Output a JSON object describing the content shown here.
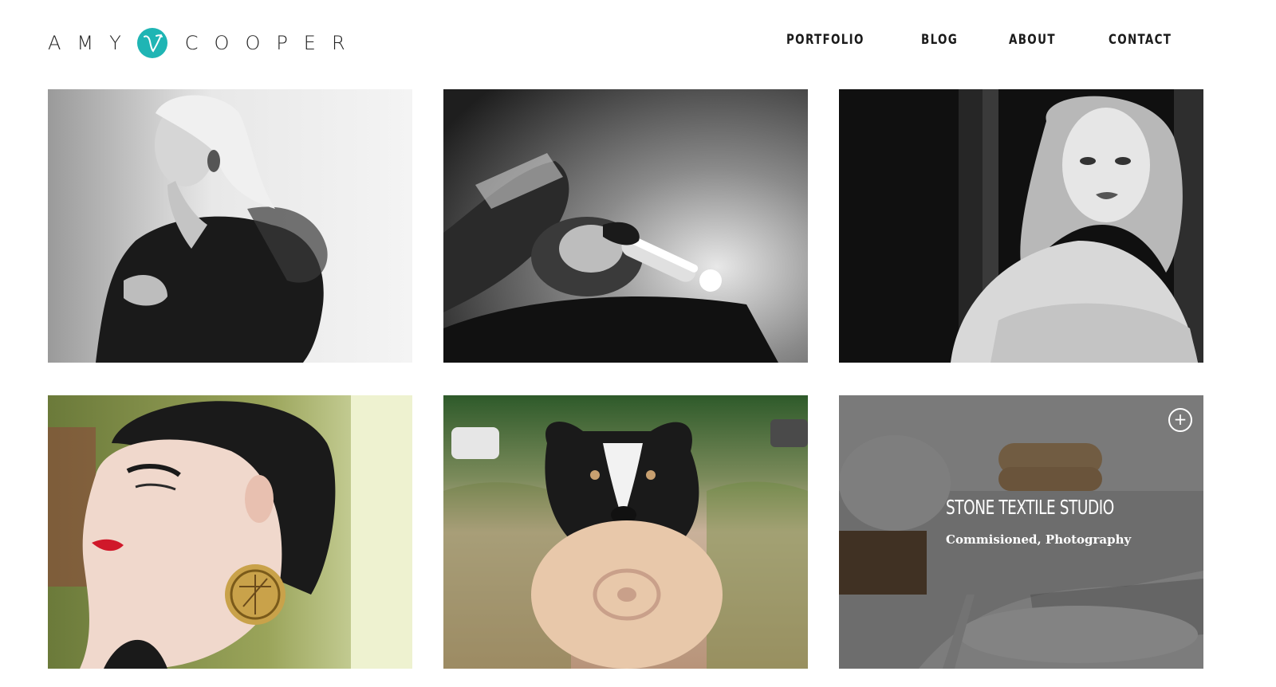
{
  "brand": {
    "first": "AMY",
    "last": "COOPER",
    "accent_color": "#1fb5b4",
    "mark_icon": "script-v-monogram"
  },
  "nav": {
    "items": [
      {
        "label": "PORTFOLIO"
      },
      {
        "label": "BLOG"
      },
      {
        "label": "ABOUT"
      },
      {
        "label": "CONTACT"
      }
    ]
  },
  "portfolio": {
    "hovered_item": {
      "title": "STONE TEXTILE STUDIO",
      "categories": "Commisioned, Photography",
      "expand_icon": "plus-circle-icon"
    }
  }
}
